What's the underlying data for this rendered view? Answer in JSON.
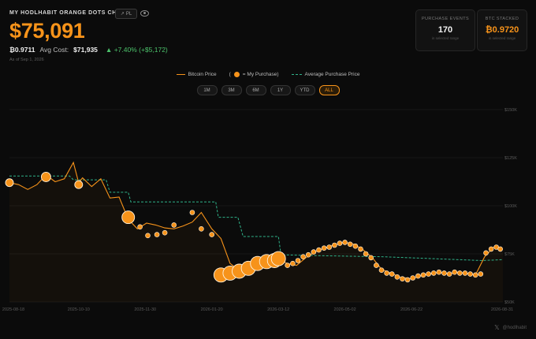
{
  "header": {
    "title": "MY HODLHABIT ORANGE DOTS CHART",
    "pl_chip": "PL",
    "price": "$75,091",
    "btc_amount": "₿0.9711",
    "avg_cost_label": "Avg Cost:",
    "avg_cost_value": "$71,935",
    "gain": "+7.40% (+$5,172)",
    "as_of": "As of Sep 1, 2026"
  },
  "stats": {
    "events_label": "PURCHASE EVENTS",
    "events_value": "170",
    "events_hint": "in selected range",
    "btc_label": "BTC STACKED",
    "btc_value": "₿0.9720",
    "btc_hint": "in selected range"
  },
  "legend": {
    "price": "Bitcoin Price",
    "purchase_open": "(",
    "purchase": "= My Purchase)",
    "average": "Average Purchase Price"
  },
  "ranges": [
    "1M",
    "3M",
    "6M",
    "1Y",
    "YTD",
    "ALL"
  ],
  "active_range": "ALL",
  "watermark": "@hodlhabit",
  "colors": {
    "price": "#f7931a",
    "average": "#2fb38a",
    "background": "#0b0b0b"
  },
  "chart_data": {
    "type": "line",
    "x_ticks": [
      "2025-08-18",
      "2025-10-10",
      "2025-11-30",
      "2026-01-20",
      "2026-03-12",
      "2026-05-02",
      "2026-06-22",
      "2026-08-31"
    ],
    "y_ticks": [
      "$150K",
      "$125K",
      "$100K",
      "$75K",
      "$50K"
    ],
    "ylim": [
      50000,
      150000
    ],
    "xlim": [
      "2025-08-18",
      "2026-08-31"
    ],
    "series": [
      {
        "name": "Bitcoin Price",
        "points": [
          [
            "2025-08-18",
            112000
          ],
          [
            "2025-08-25",
            111000
          ],
          [
            "2025-09-01",
            108500
          ],
          [
            "2025-09-08",
            111000
          ],
          [
            "2025-09-15",
            116000
          ],
          [
            "2025-09-22",
            112500
          ],
          [
            "2025-09-29",
            114000
          ],
          [
            "2025-10-06",
            122500
          ],
          [
            "2025-10-10",
            112000
          ],
          [
            "2025-10-13",
            114500
          ],
          [
            "2025-10-20",
            110000
          ],
          [
            "2025-10-27",
            114000
          ],
          [
            "2025-11-03",
            104000
          ],
          [
            "2025-11-10",
            104500
          ],
          [
            "2025-11-17",
            93000
          ],
          [
            "2025-11-24",
            88000
          ],
          [
            "2025-12-01",
            91000
          ],
          [
            "2025-12-08",
            90000
          ],
          [
            "2025-12-15",
            88500
          ],
          [
            "2025-12-22",
            88000
          ],
          [
            "2025-12-29",
            89500
          ],
          [
            "2026-01-05",
            91500
          ],
          [
            "2026-01-12",
            96500
          ],
          [
            "2026-01-20",
            88000
          ],
          [
            "2026-01-27",
            83000
          ],
          [
            "2026-02-03",
            70000
          ],
          [
            "2026-02-10",
            66500
          ],
          [
            "2026-02-17",
            68000
          ],
          [
            "2026-02-24",
            69500
          ],
          [
            "2026-03-03",
            70500
          ],
          [
            "2026-03-12",
            72000
          ],
          [
            "2026-03-19",
            70000
          ],
          [
            "2026-03-26",
            69000
          ],
          [
            "2026-04-02",
            73000
          ],
          [
            "2026-04-09",
            76000
          ],
          [
            "2026-04-16",
            78000
          ],
          [
            "2026-04-23",
            79500
          ],
          [
            "2026-05-02",
            81000
          ],
          [
            "2026-05-09",
            80000
          ],
          [
            "2026-05-16",
            77000
          ],
          [
            "2026-05-23",
            73000
          ],
          [
            "2026-05-30",
            67000
          ],
          [
            "2026-06-06",
            65000
          ],
          [
            "2026-06-13",
            63000
          ],
          [
            "2026-06-22",
            62000
          ],
          [
            "2026-06-29",
            63500
          ],
          [
            "2026-07-06",
            64500
          ],
          [
            "2026-07-13",
            65500
          ],
          [
            "2026-07-20",
            64500
          ],
          [
            "2026-07-27",
            65500
          ],
          [
            "2026-08-03",
            65000
          ],
          [
            "2026-08-10",
            64000
          ],
          [
            "2026-08-17",
            73500
          ],
          [
            "2026-08-24",
            78500
          ],
          [
            "2026-08-31",
            77500
          ]
        ]
      },
      {
        "name": "Average Purchase Price",
        "points": [
          [
            "2025-08-18",
            115500
          ],
          [
            "2025-10-03",
            115500
          ],
          [
            "2025-10-06",
            113500
          ],
          [
            "2025-10-31",
            113500
          ],
          [
            "2025-11-03",
            107000
          ],
          [
            "2025-11-17",
            107000
          ],
          [
            "2025-11-19",
            102000
          ],
          [
            "2026-01-23",
            102000
          ],
          [
            "2026-01-25",
            94000
          ],
          [
            "2026-02-09",
            94000
          ],
          [
            "2026-02-13",
            84000
          ],
          [
            "2026-03-12",
            84000
          ],
          [
            "2026-03-14",
            74500
          ],
          [
            "2026-04-15",
            74000
          ],
          [
            "2026-06-01",
            73500
          ],
          [
            "2026-08-15",
            71500
          ],
          [
            "2026-08-31",
            72000
          ]
        ]
      }
    ],
    "purchases": [
      [
        "2025-08-18",
        112000,
        5
      ],
      [
        "2025-09-15",
        115000,
        6
      ],
      [
        "2025-10-10",
        111000,
        5
      ],
      [
        "2025-11-17",
        94000,
        8
      ],
      [
        "2025-11-26",
        89000,
        3
      ],
      [
        "2025-12-02",
        84500,
        3
      ],
      [
        "2025-12-09",
        85000,
        3
      ],
      [
        "2025-12-15",
        86000,
        3
      ],
      [
        "2025-12-22",
        90000,
        3
      ],
      [
        "2026-01-05",
        96500,
        3
      ],
      [
        "2026-01-12",
        88000,
        3
      ],
      [
        "2026-01-20",
        85000,
        3
      ],
      [
        "2026-01-27",
        64000,
        9
      ],
      [
        "2026-02-03",
        65000,
        9
      ],
      [
        "2026-02-10",
        66000,
        9
      ],
      [
        "2026-02-17",
        67500,
        9
      ],
      [
        "2026-02-24",
        70000,
        9
      ],
      [
        "2026-03-03",
        71000,
        9
      ],
      [
        "2026-03-09",
        71500,
        9
      ],
      [
        "2026-03-12",
        72500,
        9
      ],
      [
        "2026-03-19",
        69000,
        3
      ],
      [
        "2026-03-23",
        70000,
        3
      ],
      [
        "2026-03-27",
        71500,
        3
      ],
      [
        "2026-03-31",
        73500,
        3
      ],
      [
        "2026-04-04",
        74500,
        3
      ],
      [
        "2026-04-08",
        76000,
        3
      ],
      [
        "2026-04-12",
        77000,
        3
      ],
      [
        "2026-04-16",
        78000,
        3
      ],
      [
        "2026-04-20",
        78500,
        3
      ],
      [
        "2026-04-24",
        79500,
        3
      ],
      [
        "2026-04-28",
        80500,
        3
      ],
      [
        "2026-05-02",
        81000,
        3
      ],
      [
        "2026-05-06",
        80000,
        3
      ],
      [
        "2026-05-10",
        79000,
        3
      ],
      [
        "2026-05-14",
        77500,
        3
      ],
      [
        "2026-05-18",
        75000,
        3
      ],
      [
        "2026-05-22",
        73000,
        3
      ],
      [
        "2026-05-26",
        69000,
        3
      ],
      [
        "2026-05-30",
        66500,
        3
      ],
      [
        "2026-06-03",
        65000,
        3
      ],
      [
        "2026-06-07",
        64500,
        3
      ],
      [
        "2026-06-11",
        63000,
        3
      ],
      [
        "2026-06-15",
        62000,
        3
      ],
      [
        "2026-06-19",
        61500,
        3
      ],
      [
        "2026-06-23",
        62500,
        3
      ],
      [
        "2026-06-27",
        63500,
        3
      ],
      [
        "2026-07-01",
        64000,
        3
      ],
      [
        "2026-07-05",
        64500,
        3
      ],
      [
        "2026-07-09",
        65000,
        3
      ],
      [
        "2026-07-13",
        65500,
        3
      ],
      [
        "2026-07-17",
        65000,
        3
      ],
      [
        "2026-07-21",
        64500,
        3
      ],
      [
        "2026-07-25",
        65500,
        3
      ],
      [
        "2026-07-29",
        65000,
        3
      ],
      [
        "2026-08-02",
        65000,
        3
      ],
      [
        "2026-08-06",
        64500,
        3
      ],
      [
        "2026-08-10",
        64000,
        3
      ],
      [
        "2026-08-14",
        64500,
        3
      ],
      [
        "2026-08-18",
        75500,
        3
      ],
      [
        "2026-08-22",
        77500,
        3
      ],
      [
        "2026-08-26",
        78500,
        3
      ],
      [
        "2026-08-29",
        77500,
        3
      ]
    ]
  }
}
